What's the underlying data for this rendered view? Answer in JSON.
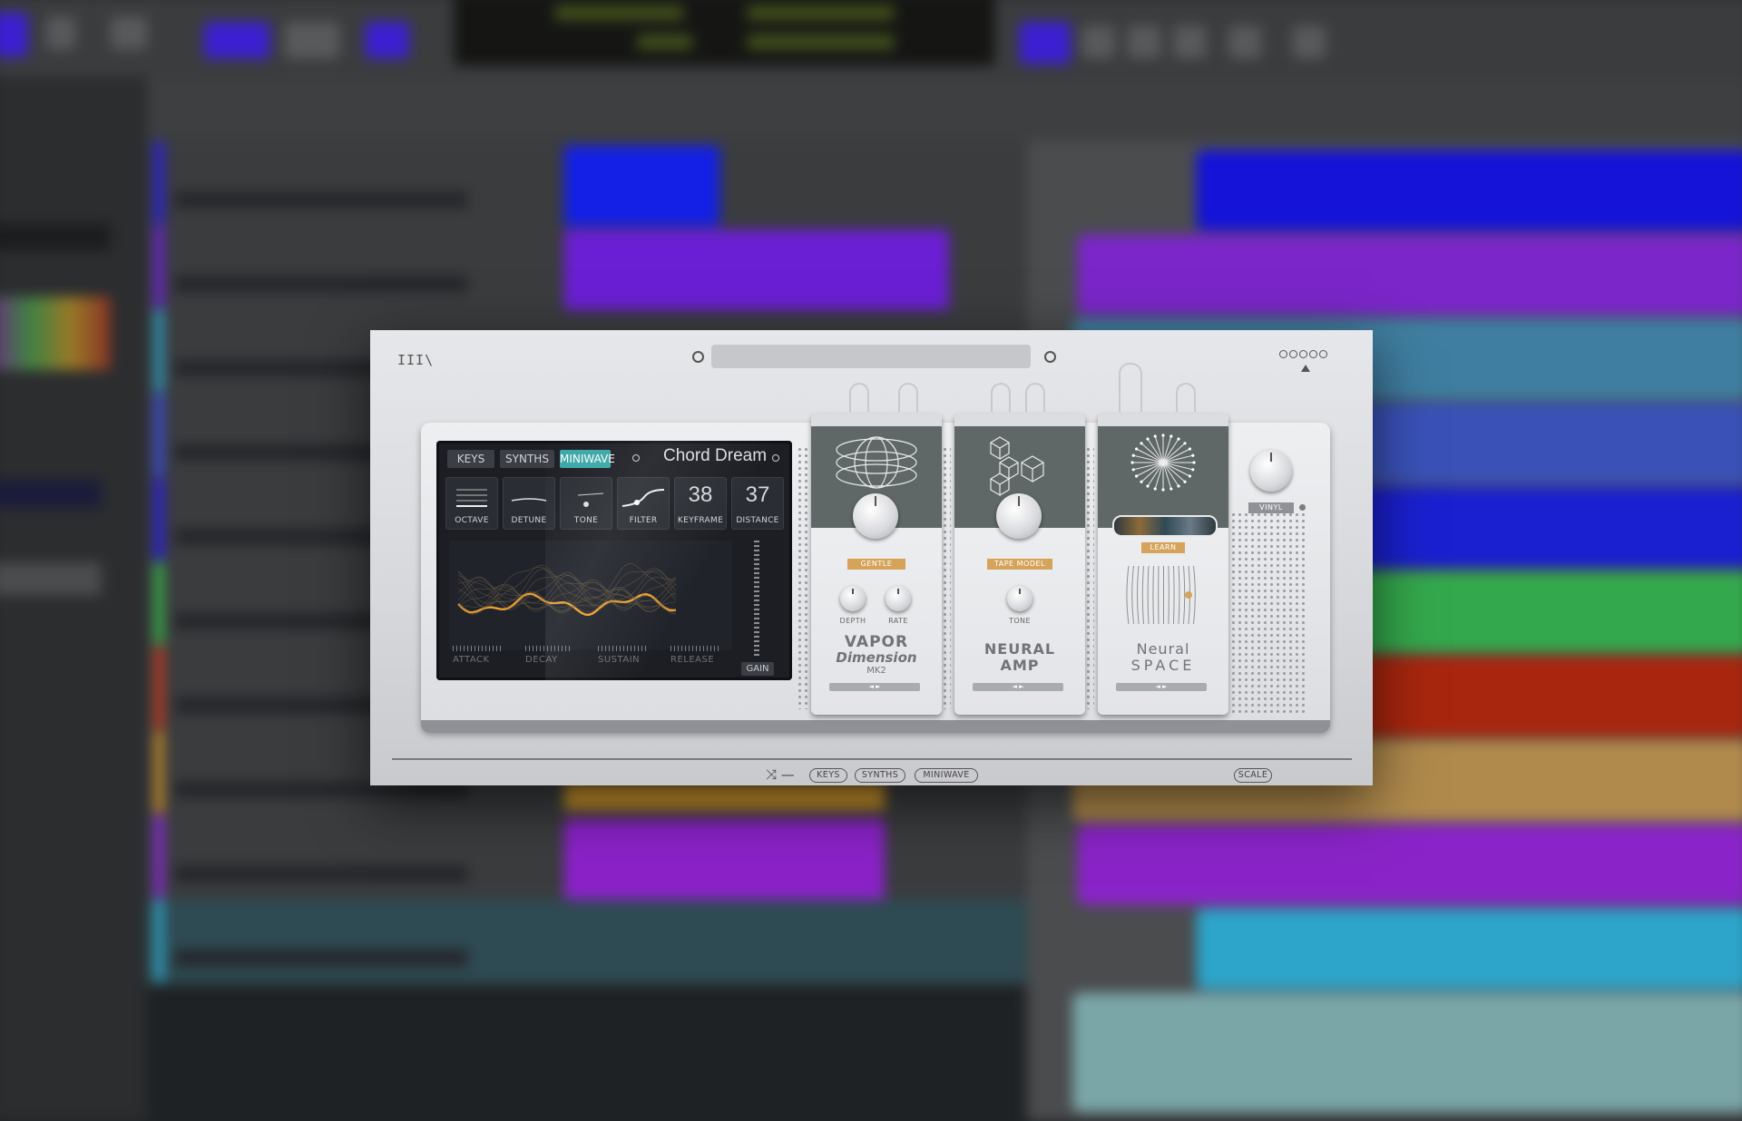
{
  "plugin": {
    "logo": "III\\",
    "screen": {
      "tabs": [
        {
          "label": "KEYS",
          "active": false
        },
        {
          "label": "SYNTHS",
          "active": false
        },
        {
          "label": "MINIWAVE",
          "active": true
        }
      ],
      "preset_name": "Chord Dream",
      "controls": [
        {
          "label": "OCTAVE",
          "icon": "octave-lines-icon"
        },
        {
          "label": "DETUNE",
          "icon": "detune-line-icon"
        },
        {
          "label": "TONE",
          "icon": "tone-dot-icon"
        },
        {
          "label": "FILTER",
          "icon": "filter-curve-icon"
        },
        {
          "label": "KEYFRAME",
          "value": "38"
        },
        {
          "label": "DISTANCE",
          "value": "37"
        }
      ],
      "envelope": [
        "ATTACK",
        "DECAY",
        "SUSTAIN",
        "RELEASE"
      ],
      "gain_label": "GAIN",
      "wave_color": "#f0a030"
    },
    "pedals": [
      {
        "id": "vapor",
        "badge": "GENTLE",
        "small_knobs": [
          "DEPTH",
          "RATE"
        ],
        "title_line1": "VAPOR",
        "title_line2": "Dimension",
        "title_line3": "MK2",
        "foot": "◄ ►"
      },
      {
        "id": "neural-amp",
        "badge": "TAPE MODEL",
        "small_knobs": [
          "TONE"
        ],
        "title_line1": "NEURAL",
        "title_line2": "AMP",
        "foot": "◄ ►"
      },
      {
        "id": "neural-space",
        "badge": "LEARN",
        "title_line1": "Neural",
        "title_line2": "SPACE",
        "foot": "◄ ►"
      }
    ],
    "vinyl_label": "VINYL",
    "footer": {
      "pills": [
        "KEYS",
        "SYNTHS",
        "MINIWAVE"
      ],
      "scale": "SCALE"
    },
    "accent_badge_color": "#d6a35a",
    "accent_tab_color": "#3aa6a6"
  }
}
